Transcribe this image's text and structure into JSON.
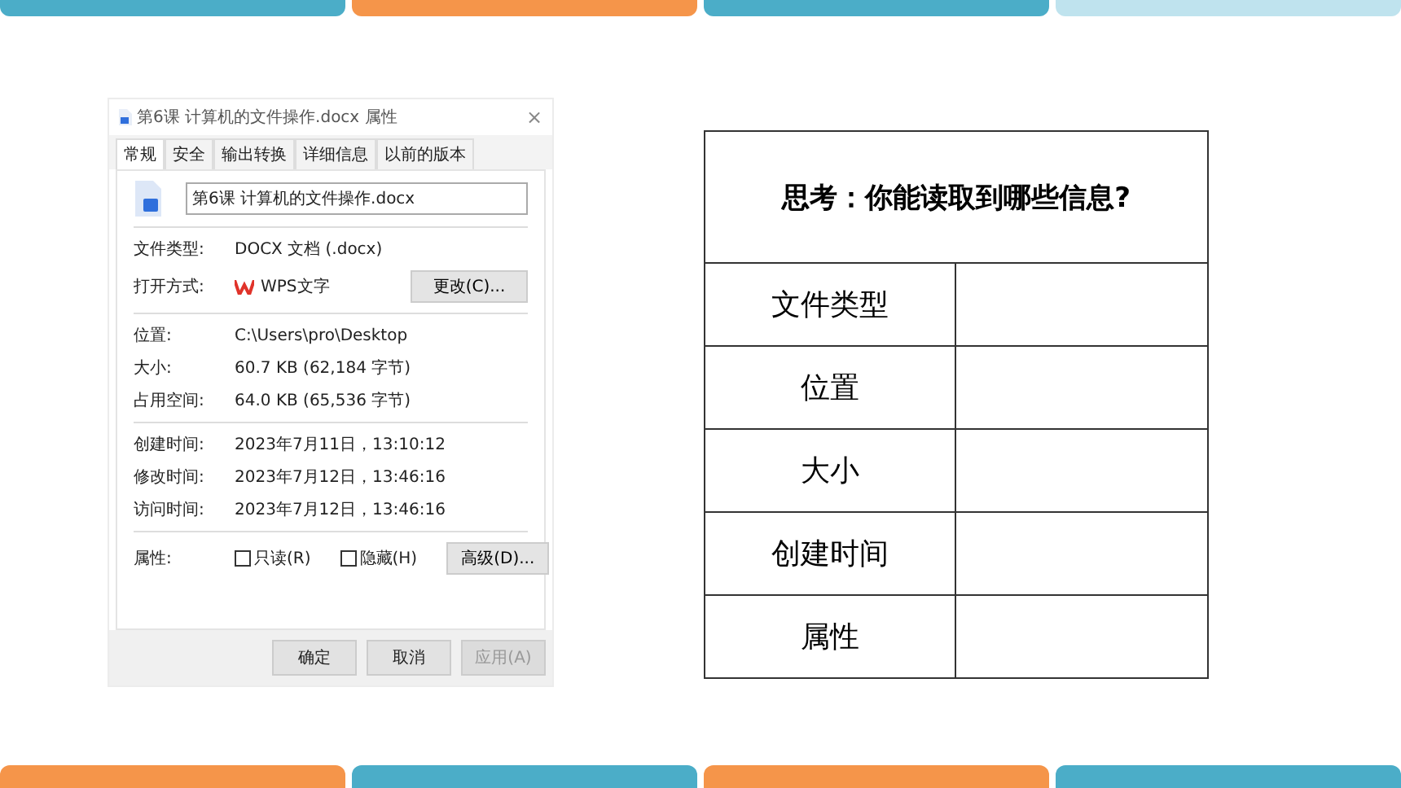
{
  "dialog": {
    "title": "第6课 计算机的文件操作.docx 属性",
    "close": "×",
    "tabs": [
      {
        "label": "常规",
        "selected": true
      },
      {
        "label": "安全",
        "selected": false
      },
      {
        "label": "输出转换",
        "selected": false
      },
      {
        "label": "详细信息",
        "selected": false
      },
      {
        "label": "以前的版本",
        "selected": false
      }
    ],
    "file_name": "第6课 计算机的文件操作.docx",
    "file_type": {
      "label": "文件类型:",
      "value": "DOCX 文档 (.docx)"
    },
    "open_with": {
      "label": "打开方式:",
      "app": "WPS文字",
      "button": "更改(C)..."
    },
    "location_rows": [
      {
        "label": "位置:",
        "value": "C:\\Users\\pro\\Desktop"
      },
      {
        "label": "大小:",
        "value": "60.7 KB (62,184 字节)"
      },
      {
        "label": "占用空间:",
        "value": "64.0 KB (65,536 字节)"
      }
    ],
    "time_rows": [
      {
        "label": "创建时间:",
        "value": "2023年7月11日，13:10:12"
      },
      {
        "label": "修改时间:",
        "value": "2023年7月12日，13:46:16"
      },
      {
        "label": "访问时间:",
        "value": "2023年7月12日，13:46:16"
      }
    ],
    "attributes": {
      "label": "属性:",
      "checkboxes": [
        {
          "label": "只读(R)",
          "checked": false
        },
        {
          "label": "隐藏(H)",
          "checked": false
        }
      ],
      "button": "高级(D)..."
    },
    "buttons": [
      {
        "label": "确定",
        "disabled": false
      },
      {
        "label": "取消",
        "disabled": false
      },
      {
        "label": "应用(A)",
        "disabled": true
      }
    ]
  },
  "table": {
    "title": "思考：你能读取到哪些信息?",
    "rows": [
      "文件类型",
      "位置",
      "大小",
      "创建时间",
      "属性"
    ]
  }
}
